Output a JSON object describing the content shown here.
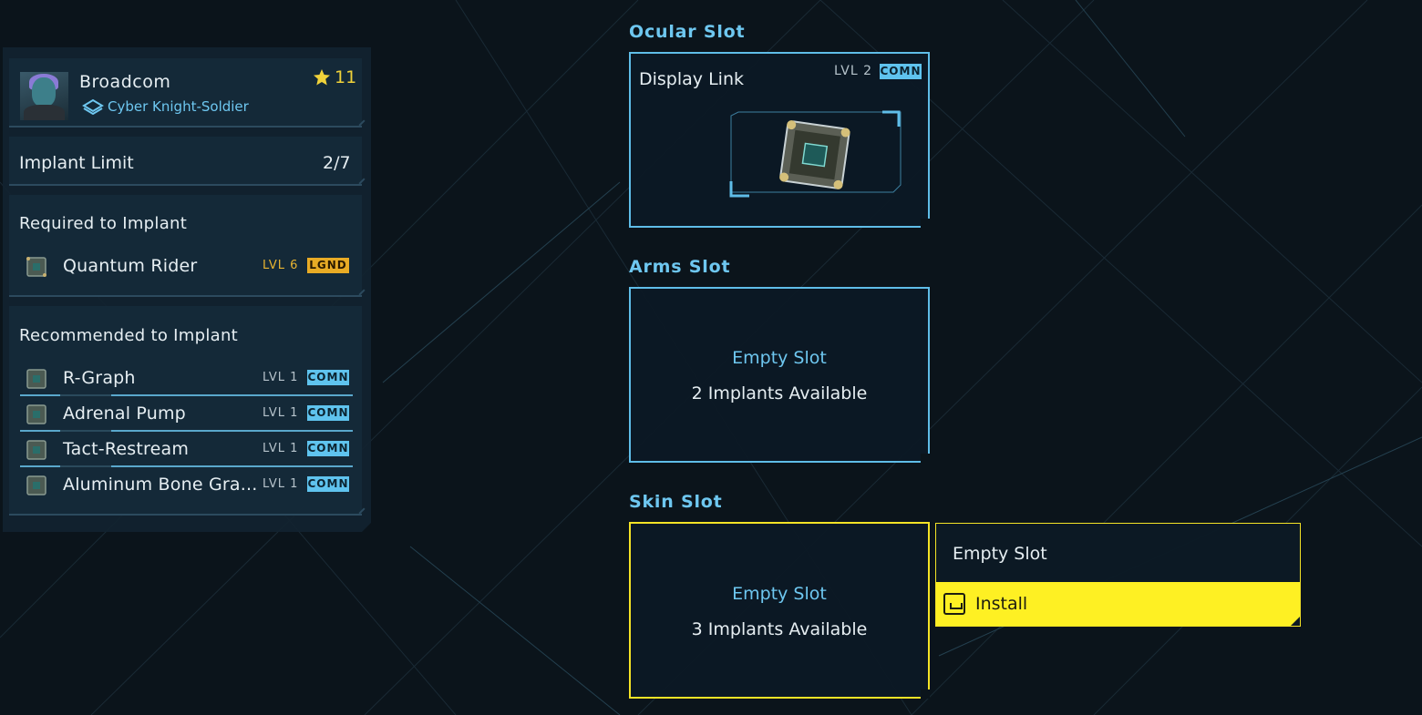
{
  "character": {
    "name": "Broadcom",
    "class": "Cyber Knight-Soldier",
    "level": "11"
  },
  "implant_limit": {
    "label": "Implant Limit",
    "value": "2/7"
  },
  "required": {
    "title": "Required to Implant",
    "items": [
      {
        "name": "Quantum Rider",
        "level": "LVL 6",
        "rarity": "LGND"
      }
    ]
  },
  "recommended": {
    "title": "Recommended to Implant",
    "items": [
      {
        "name": "R-Graph",
        "level": "LVL 1",
        "rarity": "COMN"
      },
      {
        "name": "Adrenal Pump",
        "level": "LVL 1",
        "rarity": "COMN"
      },
      {
        "name": "Tact-Restream",
        "level": "LVL 1",
        "rarity": "COMN"
      },
      {
        "name": "Aluminum Bone Gra...",
        "level": "LVL 1",
        "rarity": "COMN"
      }
    ]
  },
  "slots": {
    "ocular": {
      "title": "Ocular Slot",
      "item_name": "Display Link",
      "level": "LVL 2",
      "rarity": "COMN"
    },
    "arms": {
      "title": "Arms Slot",
      "status": "Empty Slot",
      "available": "2 Implants Available"
    },
    "skin": {
      "title": "Skin Slot",
      "status": "Empty Slot",
      "available": "3 Implants Available"
    }
  },
  "context_menu": {
    "title": "Empty Slot",
    "action_label": "Install",
    "action_key_icon": "spacebar-key-icon"
  },
  "colors": {
    "accent_blue": "#6ec7f0",
    "highlight_yellow": "#fef023",
    "legendary": "#e8ab25",
    "common": "#5fc3ee"
  }
}
